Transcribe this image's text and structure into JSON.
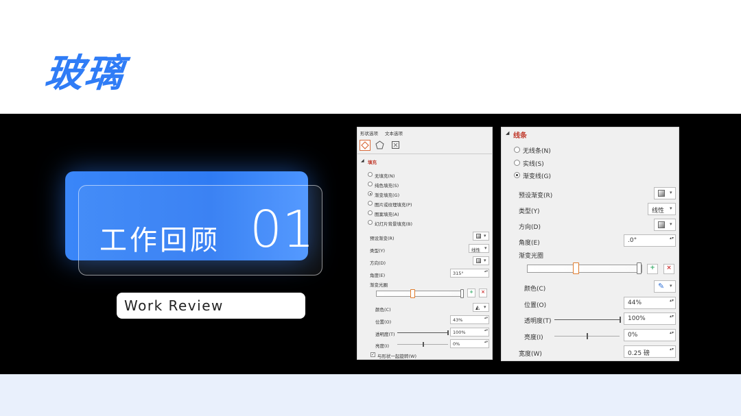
{
  "page": {
    "title": "玻璃"
  },
  "card": {
    "title": "工作回顾",
    "number": "01",
    "subtitle": "Work Review"
  },
  "panel_small": {
    "tabs": [
      "形状选项",
      "文本选项"
    ],
    "section": "填充",
    "fill_options": [
      "无填充(N)",
      "纯色填充(S)",
      "渐变填充(G)",
      "图片或纹理填充(P)",
      "图案填充(A)",
      "幻灯片背景填充(B)"
    ],
    "selected_fill": 2,
    "preset_label": "预设渐变(R)",
    "type_label": "类型(Y)",
    "type_value": "线性",
    "direction_label": "方向(D)",
    "angle_label": "角度(E)",
    "angle_value": "315°",
    "stops_label": "渐变光圈",
    "color_label": "颜色(C)",
    "position_label": "位置(O)",
    "position_value": "43%",
    "transparency_label": "透明度(T)",
    "transparency_value": "100%",
    "brightness_label": "亮度(I)",
    "brightness_value": "0%",
    "rotate_label": "与形状一起旋转(W)"
  },
  "panel_large": {
    "section": "线条",
    "line_options": [
      "无线条(N)",
      "实线(S)",
      "渐变线(G)"
    ],
    "selected_line": 2,
    "preset_label": "预设渐变(R)",
    "type_label": "类型(Y)",
    "type_value": "线性",
    "direction_label": "方向(D)",
    "angle_label": "角度(E)",
    "angle_value": ".0°",
    "stops_label": "渐变光圈",
    "color_label": "颜色(C)",
    "position_label": "位置(O)",
    "position_value": "44%",
    "transparency_label": "透明度(T)",
    "transparency_value": "100%",
    "brightness_label": "亮度(I)",
    "brightness_value": "0%",
    "width_label": "宽度(W)",
    "width_value": "0.25 磅"
  },
  "colors": {
    "accent": "#2f7cf6",
    "band": "#000000",
    "bottom": "#e9f0fc",
    "section_red": "#c0392b"
  }
}
